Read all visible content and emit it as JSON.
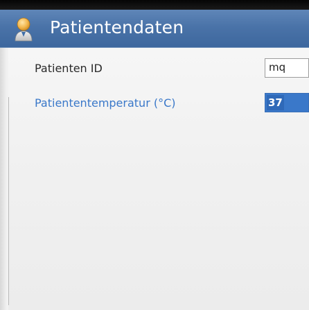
{
  "header": {
    "title": "Patientendaten",
    "icon": "patient-person-icon",
    "background_color": "#4a73a8"
  },
  "form": {
    "fields": [
      {
        "label": "Patienten ID",
        "value": "mq",
        "state": "normal"
      },
      {
        "label": "Patiententemperatur (°C)",
        "value": "37",
        "state": "focused-selected",
        "label_color": "#3a78c9"
      }
    ]
  }
}
